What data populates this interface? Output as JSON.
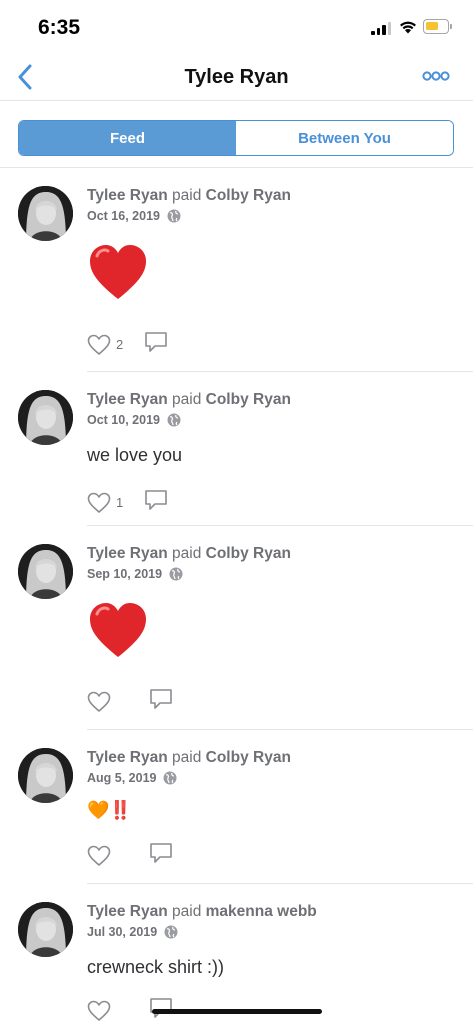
{
  "status_bar": {
    "time": "6:35",
    "battery_color": "#f4c531"
  },
  "nav": {
    "title": "Tylee Ryan",
    "back_icon": "chevron-left-icon",
    "more_icon": "more-icon"
  },
  "tabs": [
    {
      "label": "Feed",
      "active": true
    },
    {
      "label": "Between You",
      "active": false
    }
  ],
  "accent": "#4a90d9",
  "feed": [
    {
      "actor": "Tylee Ryan",
      "verb": "paid",
      "target": "Colby Ryan",
      "date": "Oct 16, 2019",
      "note_emoji": "red-heart",
      "likes": "2"
    },
    {
      "actor": "Tylee Ryan",
      "verb": "paid",
      "target": "Colby Ryan",
      "date": "Oct 10, 2019",
      "note_text": "we love you",
      "likes": "1"
    },
    {
      "actor": "Tylee Ryan",
      "verb": "paid",
      "target": "Colby Ryan",
      "date": "Sep 10, 2019",
      "note_emoji": "red-heart",
      "likes": ""
    },
    {
      "actor": "Tylee Ryan",
      "verb": "paid",
      "target": "Colby Ryan",
      "date": "Aug 5, 2019",
      "note_text": "🧡‼️",
      "likes": ""
    },
    {
      "actor": "Tylee Ryan",
      "verb": "paid",
      "target": "makenna webb",
      "date": "Jul 30, 2019",
      "note_text": "crewneck shirt :))",
      "likes": ""
    }
  ]
}
